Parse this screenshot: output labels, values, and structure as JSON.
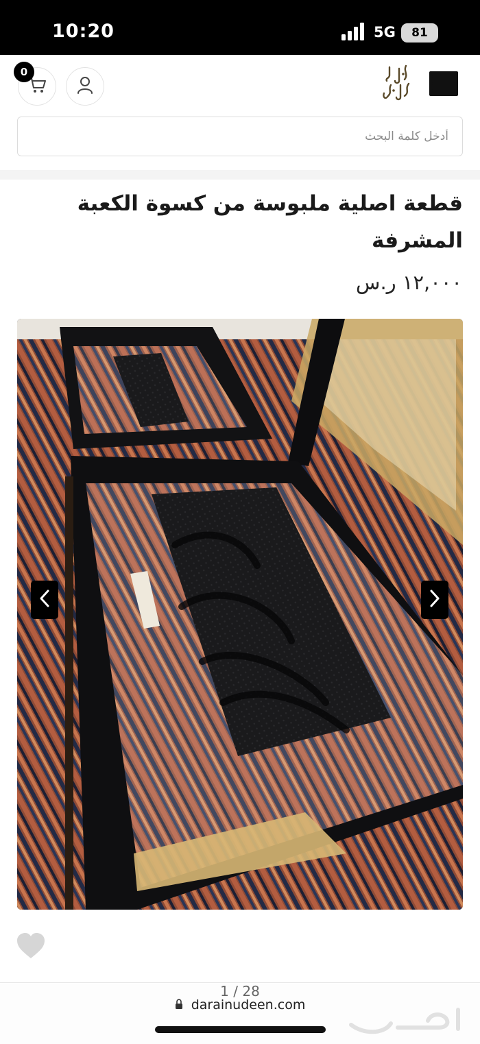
{
  "status_bar": {
    "time": "10:20",
    "network": "5G",
    "battery": "81"
  },
  "header": {
    "cart_badge": "0",
    "logo_text": "دار عين الدين"
  },
  "search": {
    "placeholder": "أدخل كلمة البحث"
  },
  "product": {
    "title": "قطعة اصلية ملبوسة من كسوة الكعبة المشرفة",
    "price": "١٢,٠٠٠ ر.س"
  },
  "gallery": {
    "counter": "1 / 28"
  },
  "browser": {
    "url": "darainudeen.com"
  },
  "watermark": {
    "text": "حراج"
  },
  "icons": [
    "cart-icon",
    "user-icon",
    "menu-icon",
    "chevron-left-icon",
    "chevron-right-icon",
    "heart-icon",
    "lock-icon"
  ]
}
